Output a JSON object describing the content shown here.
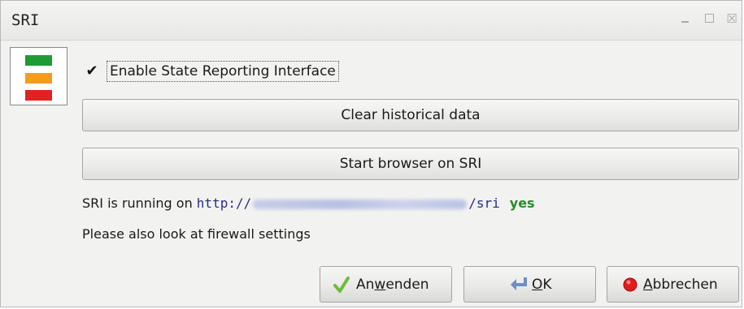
{
  "window": {
    "title": "SRI",
    "controls": {
      "minimize_icon": "minimize-icon",
      "maximize_icon": "maximize-icon",
      "close_icon": "close-icon",
      "close_glyph": "☒"
    }
  },
  "logo": {
    "colors": [
      "#1f9b36",
      "#f39c1e",
      "#e42020"
    ]
  },
  "enable_checkbox": {
    "label": "Enable State Reporting Interface",
    "checked": true,
    "glyph": "✔"
  },
  "buttons": {
    "clear_history": "Clear historical data",
    "start_browser": "Start browser on SRI"
  },
  "status": {
    "prefix": "SRI is running on ",
    "url_start": "http://",
    "url_end": "/sri",
    "running": "yes"
  },
  "firewall_note": "Please also look at firewall settings",
  "dialog": {
    "apply": {
      "pre": "An",
      "mnemonic": "w",
      "post": "enden",
      "icon": "checkmark-icon"
    },
    "ok": {
      "pre": "",
      "mnemonic": "O",
      "post": "K",
      "icon": "enter-arrow-icon"
    },
    "cancel": {
      "pre": "",
      "mnemonic": "A",
      "post": "bbrechen",
      "icon": "stop-icon"
    }
  },
  "colors": {
    "running_yes": "#2c8a2c",
    "url": "#2a2a8a"
  }
}
